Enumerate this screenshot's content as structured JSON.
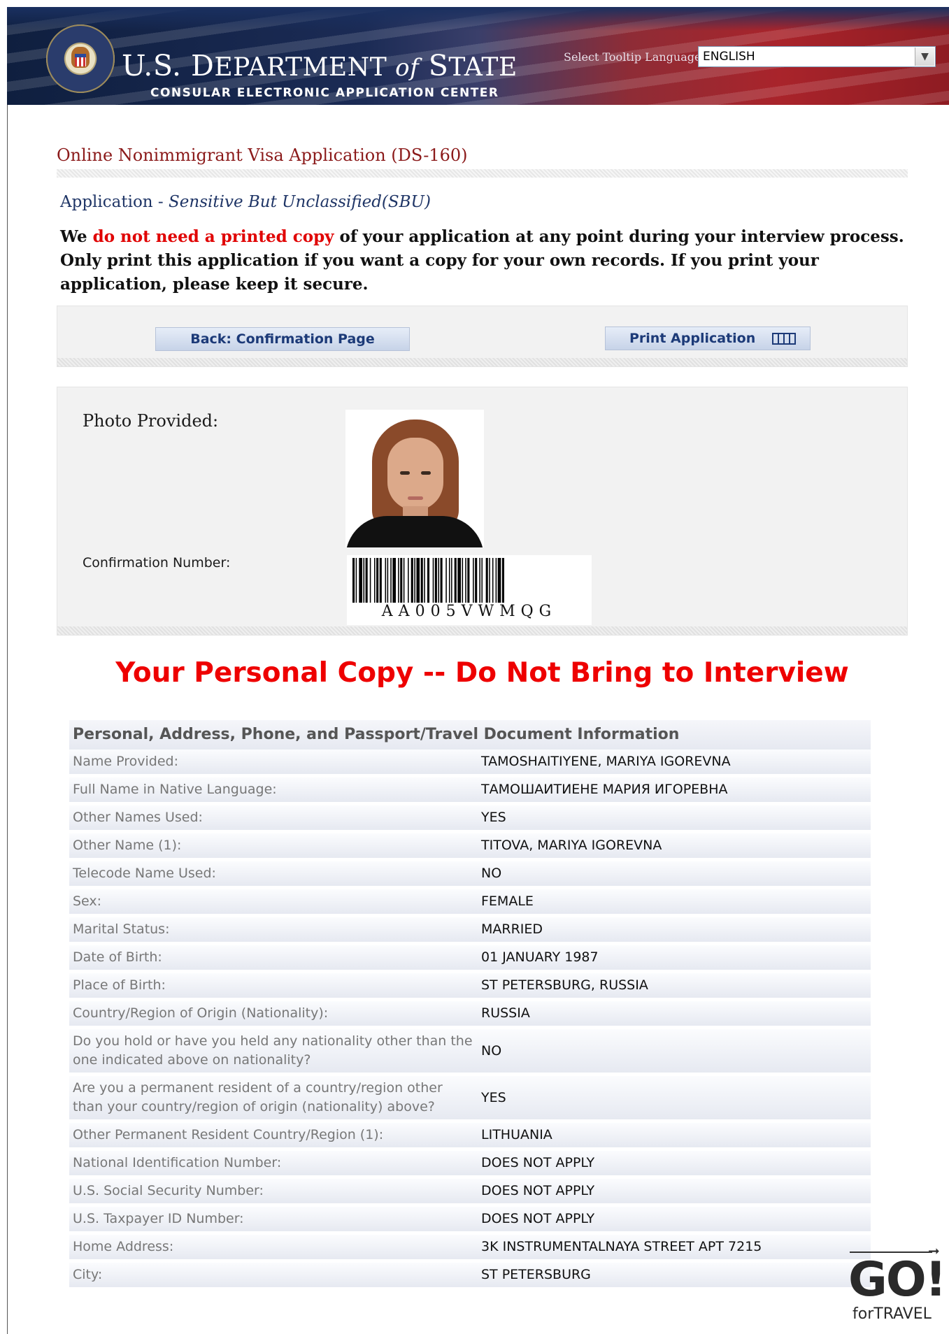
{
  "header": {
    "dept_prefix": "U.S. D",
    "dept_mid": "EPARTMENT ",
    "dept_of": "of",
    "dept_state_s": " S",
    "dept_state_rest": "TATE",
    "subtitle": "CONSULAR ELECTRONIC APPLICATION CENTER",
    "tooltip_label": "Select Tooltip Language",
    "language_selected": "ENGLISH",
    "seal_icon": "department-of-state-seal"
  },
  "page": {
    "app_title": "Online Nonimmigrant Visa Application (DS-160)",
    "section_prefix": "Application - ",
    "section_italic": "Sensitive But Unclassified(SBU)",
    "notice_pre": "We ",
    "notice_red": "do not need a printed copy",
    "notice_post": " of your application at any point during your interview process. Only print this application if you want a copy for your own records. If you print your application, please keep it secure."
  },
  "buttons": {
    "back_label": "Back: Confirmation Page",
    "print_label": "Print Application",
    "print_icon": "print-icon"
  },
  "photo_box": {
    "photo_label": "Photo Provided:",
    "confirmation_label": "Confirmation Number:",
    "confirmation_number": "AA005VWMQG"
  },
  "warning": "Your Personal Copy -- Do Not Bring to Interview",
  "data_table": {
    "section_title": "Personal, Address, Phone, and Passport/Travel Document Information",
    "rows": [
      {
        "label": "Name Provided:",
        "value": "TAMOSHAITIYENE, MARIYA IGOREVNA"
      },
      {
        "label": "Full Name in Native Language:",
        "value": "ТАМОШАИТИЕНЕ МАРИЯ ИГОРЕВНА"
      },
      {
        "label": "Other Names Used:",
        "value": "YES"
      },
      {
        "label": "Other Name (1):",
        "value": "TITOVA, MARIYA IGOREVNA"
      },
      {
        "label": "Telecode Name Used:",
        "value": "NO"
      },
      {
        "label": "Sex:",
        "value": "FEMALE"
      },
      {
        "label": "Marital Status:",
        "value": "MARRIED"
      },
      {
        "label": "Date of Birth:",
        "value": "01 JANUARY 1987"
      },
      {
        "label": "Place of Birth:",
        "value": "ST PETERSBURG, RUSSIA"
      },
      {
        "label": "Country/Region of Origin (Nationality):",
        "value": "RUSSIA"
      },
      {
        "label": "Do you hold or have you held any nationality other than the one indicated above on nationality?",
        "value": "NO"
      },
      {
        "label": "Are you a permanent resident of a country/region other than your country/region of origin (nationality) above?",
        "value": "YES"
      },
      {
        "label": "Other Permanent Resident Country/Region (1):",
        "value": "LITHUANIA"
      },
      {
        "label": "National Identification Number:",
        "value": "DOES NOT APPLY"
      },
      {
        "label": "U.S. Social Security Number:",
        "value": "DOES NOT APPLY"
      },
      {
        "label": "U.S. Taxpayer ID Number:",
        "value": "DOES NOT APPLY"
      },
      {
        "label": "Home Address:",
        "value": "3K INSTRUMENTALNAYA STREET APT 7215"
      },
      {
        "label": "City:",
        "value": "ST PETERSBURG"
      }
    ]
  },
  "watermark": {
    "brand": "GO!",
    "tagline": "forTRAVEL"
  }
}
